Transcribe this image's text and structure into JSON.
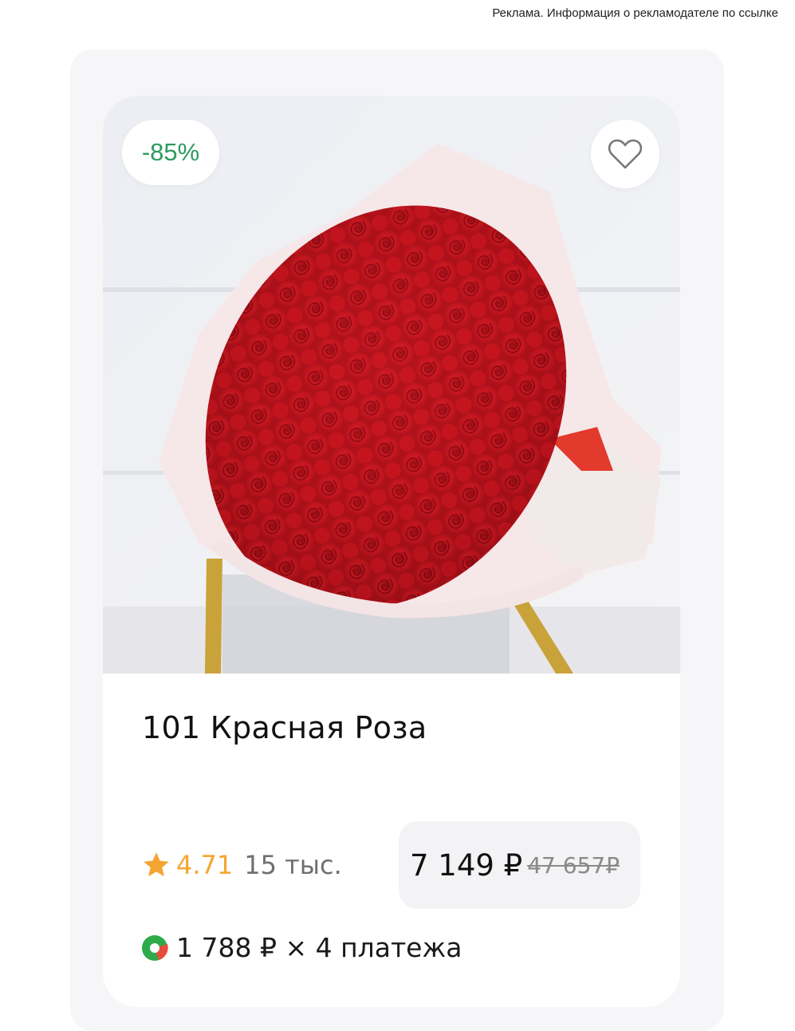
{
  "ad_note": "Реклама. Информация о рекламодателе по ссылке",
  "product": {
    "discount": "-85%",
    "title": "101 Красная Роза",
    "rating": "4.71",
    "reviews_count": "15 тыс.",
    "price_current": "7 149 ₽",
    "price_old": "47 657₽",
    "installment": "1 788 ₽ × 4 платежа"
  },
  "icons": {
    "favorite": "heart-icon",
    "rating": "star-icon",
    "installment": "payment-icon",
    "image": "rose-bouquet-image"
  },
  "colors": {
    "discount": "#2e9a5f",
    "rating": "#f4a531",
    "rose": "#b8111a",
    "price_box": "#f3f3f5"
  }
}
